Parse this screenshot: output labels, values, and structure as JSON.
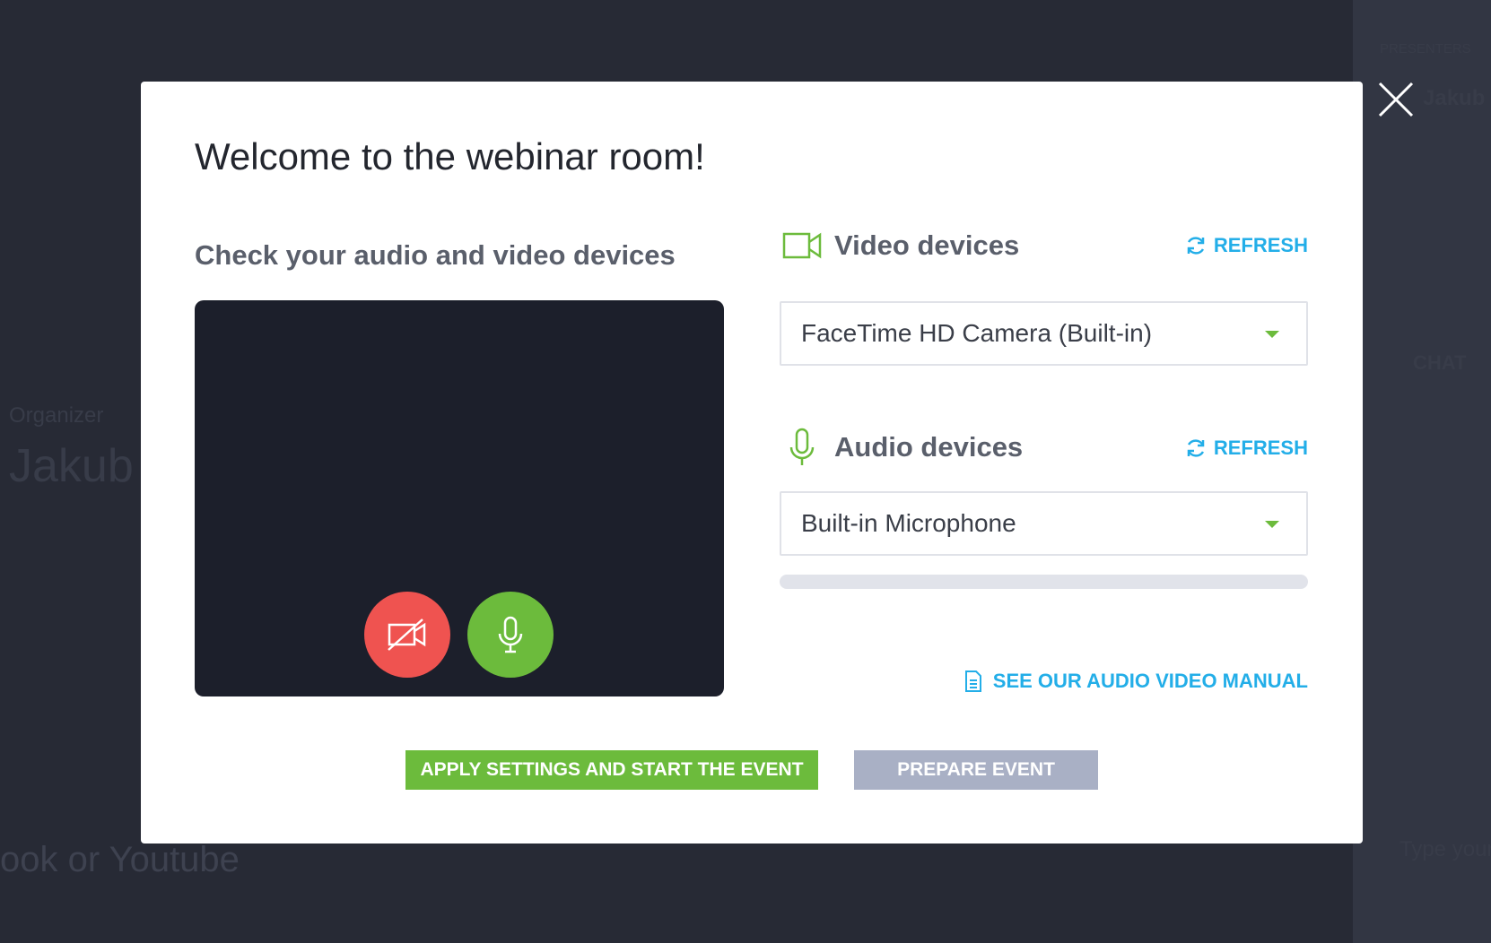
{
  "background": {
    "presenters_label": "PRESENTERS",
    "presenter_name": "Jakub Z",
    "chat_label": "CHAT",
    "chat_placeholder": "Type your",
    "organizer_label": "Organizer",
    "organizer_name": "Jakub",
    "stream_text": "ook or Youtube"
  },
  "modal": {
    "title": "Welcome to the webinar room!",
    "subtitle": "Check your audio and video devices",
    "camera_toggle": {
      "icon": "video-off-icon",
      "state": "off",
      "color": "#ef5350"
    },
    "mic_toggle": {
      "icon": "microphone-icon",
      "state": "on",
      "color": "#6cbb3c"
    },
    "video_devices": {
      "label": "Video devices",
      "refresh_label": "REFRESH",
      "selected": "FaceTime HD Camera (Built-in)"
    },
    "audio_devices": {
      "label": "Audio devices",
      "refresh_label": "REFRESH",
      "selected": "Built-in Microphone",
      "level": 0
    },
    "manual_link": "SEE OUR AUDIO VIDEO MANUAL",
    "apply_button": "APPLY SETTINGS AND START THE EVENT",
    "prepare_button": "PREPARE EVENT"
  },
  "colors": {
    "accent_green": "#6cbb3c",
    "link_blue": "#23aee8",
    "danger_red": "#ef5350",
    "disabled_gray": "#a9b0c5"
  }
}
